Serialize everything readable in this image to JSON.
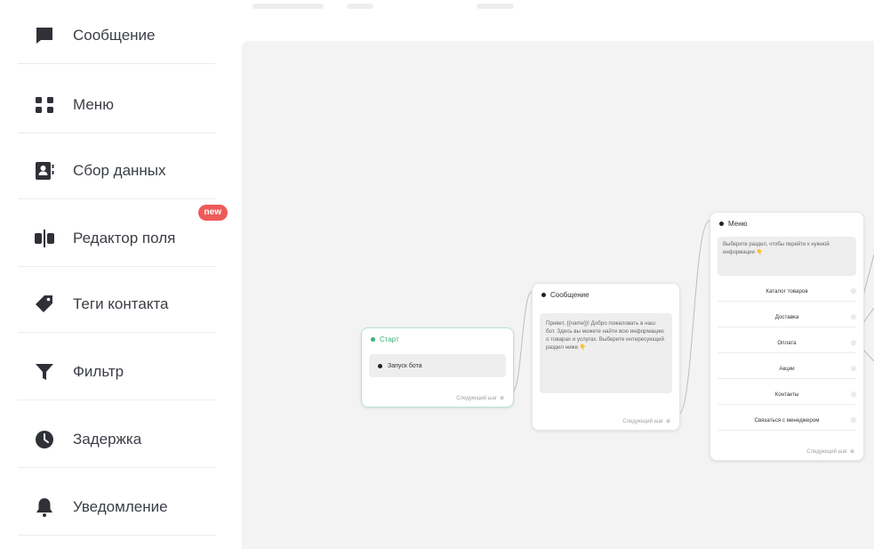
{
  "sidebar": {
    "items": [
      {
        "label": "Сообщение",
        "icon": "message-icon"
      },
      {
        "label": "Меню",
        "icon": "menu-grid-icon"
      },
      {
        "label": "Сбор данных",
        "icon": "contact-card-icon"
      },
      {
        "label": "Редактор поля",
        "icon": "field-editor-icon",
        "badge": "new"
      },
      {
        "label": "Теги контакта",
        "icon": "tag-icon"
      },
      {
        "label": "Фильтр",
        "icon": "filter-icon"
      },
      {
        "label": "Задержка",
        "icon": "clock-icon"
      },
      {
        "label": "Уведомление",
        "icon": "bell-icon"
      }
    ]
  },
  "canvas": {
    "start_node": {
      "title": "Старт",
      "trigger": "Запуск бота",
      "footer": "Следующий шаг"
    },
    "message_node": {
      "title": "Сообщение",
      "text": "Привет, {{name}}! Добро пожаловать в наш бот. Здесь вы можете найти всю информацию о товарах и услугах. Выберите интересующий раздел ниже 👇",
      "footer": "Следующий шаг"
    },
    "menu_node": {
      "title": "Меню",
      "text": "Выберите раздел, чтобы перейти к нужной информации 👇",
      "buttons": [
        "Каталог товаров",
        "Доставка",
        "Оплата",
        "Акции",
        "Контакты",
        "Связаться с менеджером"
      ],
      "footer": "Следующий шаг"
    }
  },
  "colors": {
    "accent_green": "#3cae7c",
    "badge_red": "#ef5a5a",
    "canvas_bg": "#f3f3f3"
  }
}
